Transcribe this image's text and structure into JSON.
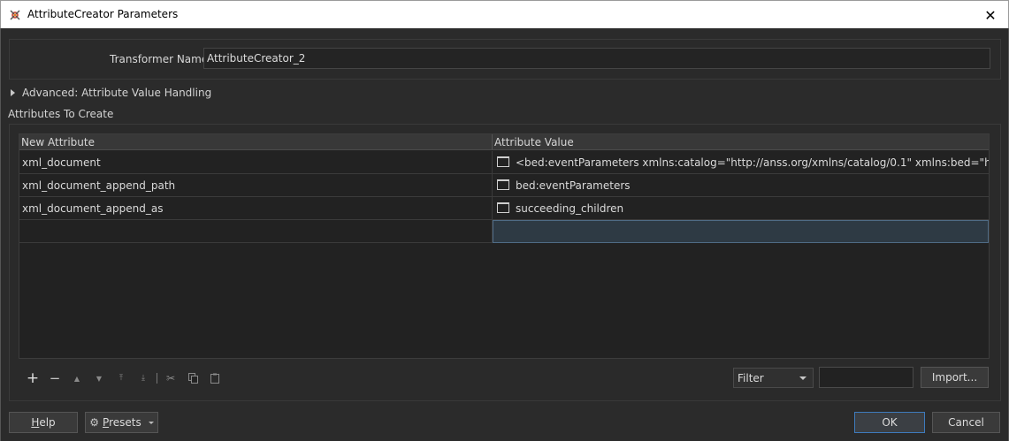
{
  "window": {
    "title": "AttributeCreator Parameters"
  },
  "transformer": {
    "label": "Transformer Name:",
    "value": "AttributeCreator_2"
  },
  "advanced": {
    "label": "Advanced: Attribute Value Handling"
  },
  "attributes": {
    "section_label": "Attributes To Create",
    "columns": [
      "New Attribute",
      "Attribute Value"
    ],
    "rows": [
      {
        "name": "xml_document",
        "value": "<bed:eventParameters xmlns:catalog=\"http://anss.org/xmlns/catalog/0.1\" xmlns:bed=\"http://qua..."
      },
      {
        "name": "xml_document_append_path",
        "value": "bed:eventParameters"
      },
      {
        "name": "xml_document_append_as",
        "value": "succeeding_children"
      },
      {
        "name": "",
        "value": ""
      }
    ]
  },
  "toolbar": {
    "icons": [
      "add-icon",
      "remove-icon",
      "move-up-icon",
      "move-down-icon",
      "move-top-icon",
      "move-bottom-icon",
      "cut-icon",
      "copy-icon",
      "paste-icon"
    ]
  },
  "filter": {
    "selected": "Filter",
    "value": ""
  },
  "buttons": {
    "import": "Import...",
    "help_prefix": "",
    "help_underlined": "H",
    "help_rest": "elp",
    "presets_underlined": "P",
    "presets_rest": "resets",
    "ok": "OK",
    "cancel": "Cancel"
  },
  "colors": {
    "accent": "#3e7bbd",
    "background": "#2b2b2b",
    "selection": "#2e3a44"
  }
}
